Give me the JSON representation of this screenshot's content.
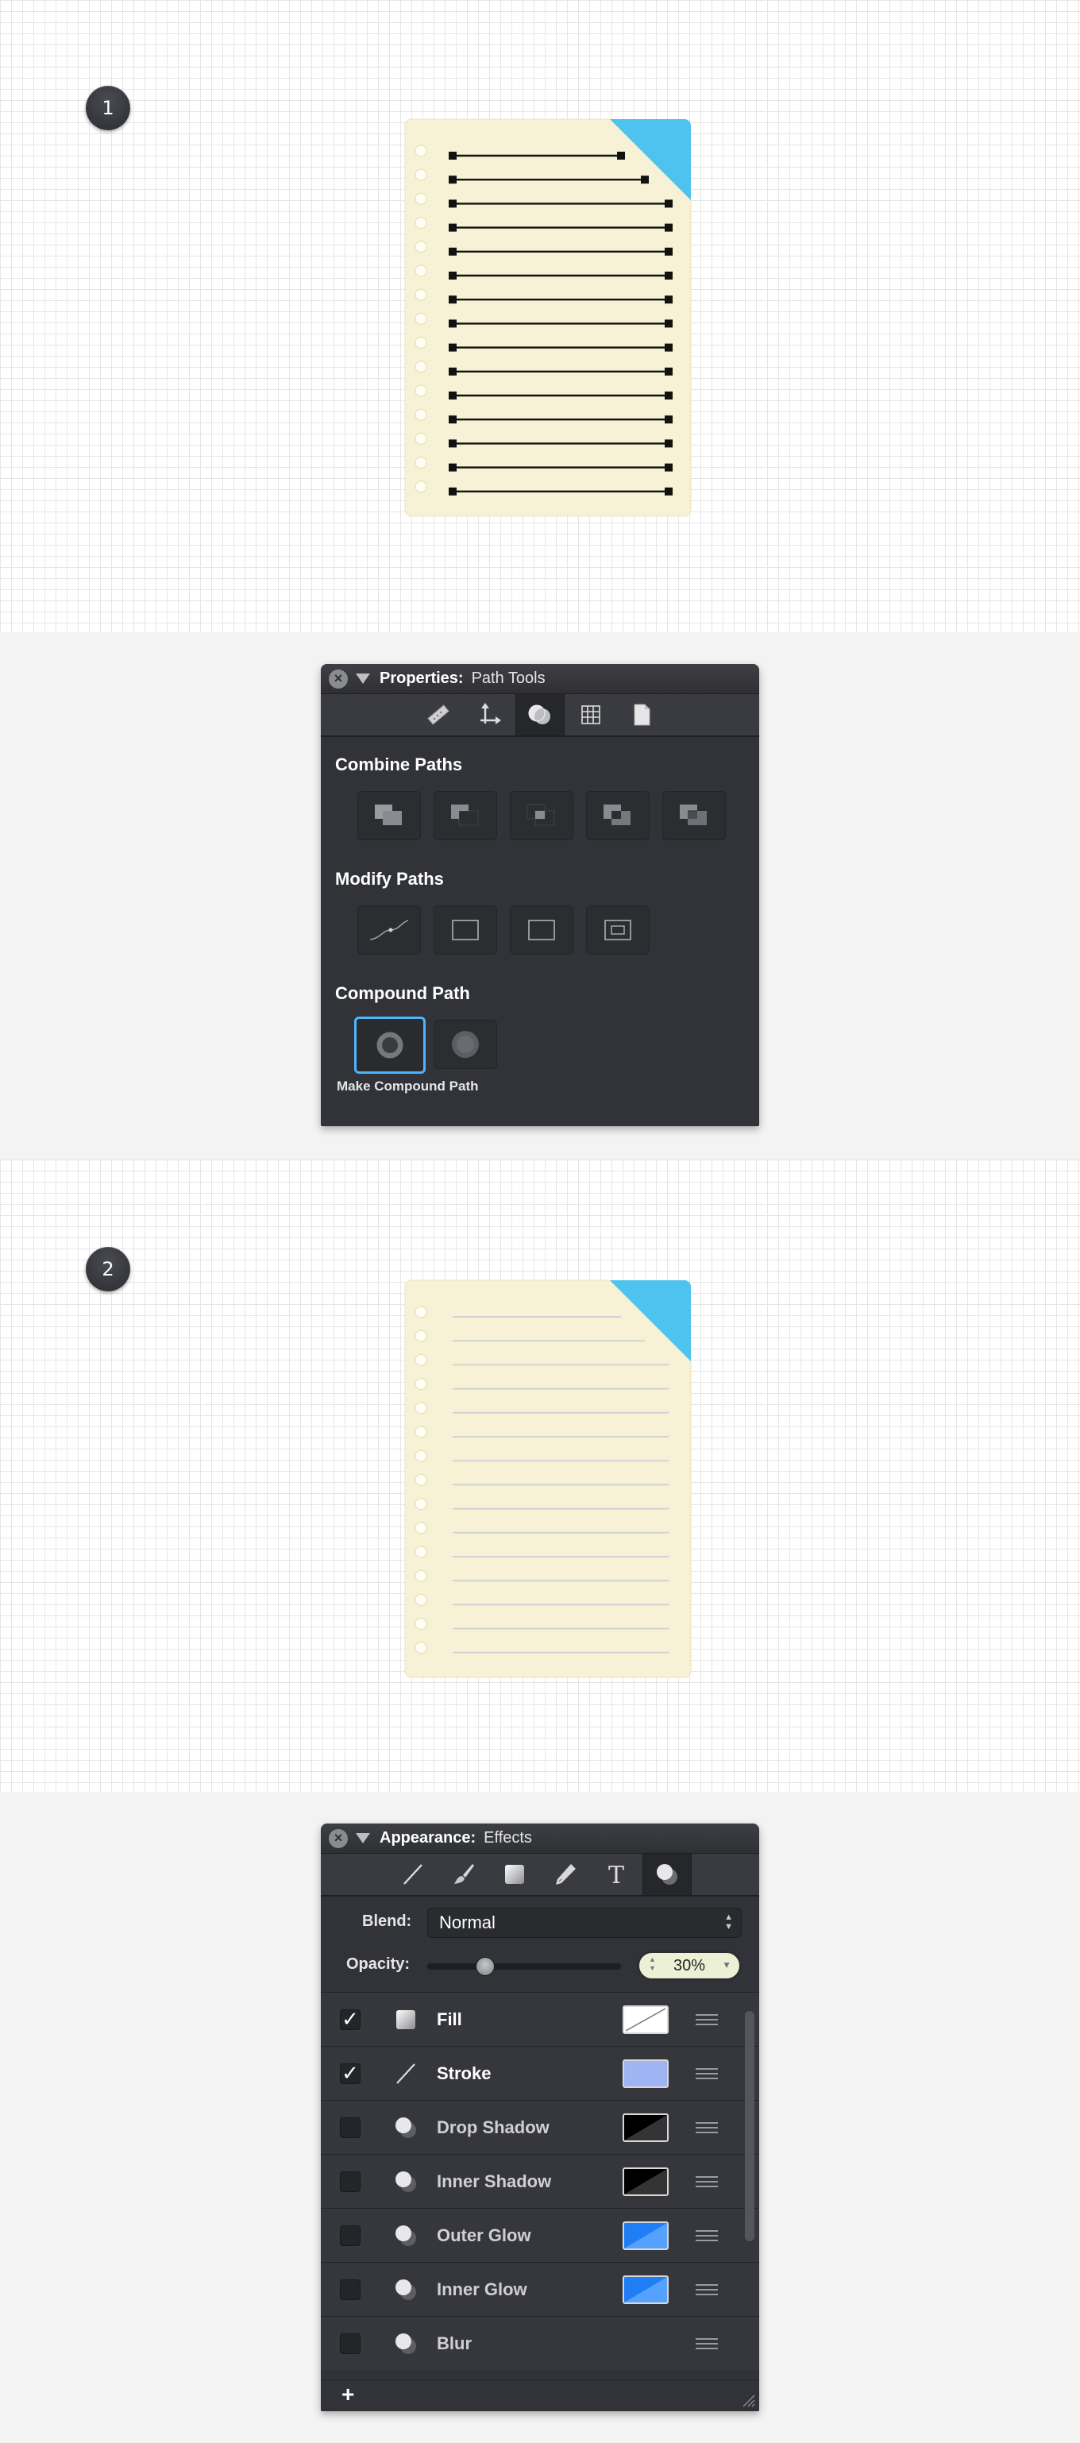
{
  "step1": {
    "badge": "1"
  },
  "properties_panel": {
    "title": "Properties:",
    "subtitle": "Path Tools",
    "toolbar_icons": [
      "ruler-icon",
      "transform-icon",
      "path-tools-icon",
      "grid-icon",
      "document-icon"
    ],
    "active_tool": "path-tools-icon",
    "combine_heading": "Combine Paths",
    "combine_buttons": [
      "union-icon",
      "subtract-icon",
      "intersect-icon",
      "exclude-icon",
      "divide-icon"
    ],
    "modify_heading": "Modify Paths",
    "modify_buttons": [
      "simplify-path-icon",
      "offset-path-icon",
      "outline-stroke-icon",
      "inset-path-icon"
    ],
    "compound_heading": "Compound Path",
    "compound_buttons": [
      "make-compound-path-icon",
      "release-compound-path-icon"
    ],
    "compound_caption": "Make Compound Path",
    "highlight_color": "#4db5ff"
  },
  "step2": {
    "badge": "2"
  },
  "appearance_panel": {
    "title": "Appearance:",
    "subtitle": "Effects",
    "toolbar_icons": [
      "line-icon",
      "brush-icon",
      "fill-square-icon",
      "pen-icon",
      "text-icon",
      "effects-icon"
    ],
    "active_tool": "effects-icon",
    "blend_label": "Blend:",
    "blend_value": "Normal",
    "opacity_label": "Opacity:",
    "opacity_value": "30%",
    "opacity_fraction": 0.3,
    "effects": [
      {
        "name": "Fill",
        "checked": true,
        "icon": "fill-icon",
        "swatch": "none"
      },
      {
        "name": "Stroke",
        "checked": true,
        "icon": "stroke-icon",
        "swatch": "#9fb4f3"
      },
      {
        "name": "Drop Shadow",
        "checked": false,
        "icon": "effect-icon",
        "swatch": "#000000"
      },
      {
        "name": "Inner Shadow",
        "checked": false,
        "icon": "effect-icon",
        "swatch": "#000000"
      },
      {
        "name": "Outer Glow",
        "checked": false,
        "icon": "effect-icon",
        "swatch": "#1f7df5"
      },
      {
        "name": "Inner Glow",
        "checked": false,
        "icon": "effect-icon",
        "swatch": "#1f7df5"
      },
      {
        "name": "Blur",
        "checked": false,
        "icon": "effect-icon",
        "swatch": ""
      }
    ],
    "add_label": "+"
  },
  "colors": {
    "paper": "#f7f1d5",
    "corner": "#4fc3ef",
    "panel": "#323338",
    "line_gray": "#cfd3d3"
  }
}
